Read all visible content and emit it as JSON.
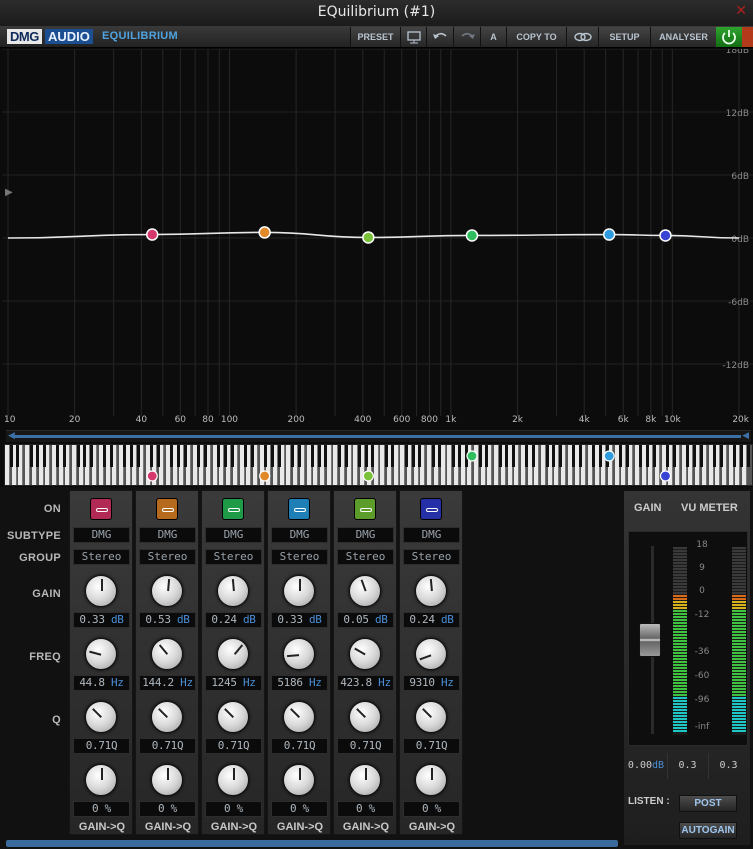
{
  "window": {
    "title": "EQuilibrium (#1)",
    "close": "✕"
  },
  "toolbar": {
    "brand_dmg": "DMG",
    "brand_audio": "AUDIO",
    "product": "EQUILIBRIUM",
    "buttons": [
      {
        "label": "PRESET"
      },
      {
        "label": ""
      },
      {
        "label": ""
      },
      {
        "label": ""
      },
      {
        "label": "A"
      },
      {
        "label": "COPY TO"
      },
      {
        "label": ""
      },
      {
        "label": "SETUP"
      },
      {
        "label": "ANALYSER"
      }
    ],
    "icons": {
      "monitor": "monitor-icon",
      "undo": "undo-icon",
      "redo": "redo-icon",
      "link": "link-icon",
      "power": "power-icon"
    }
  },
  "graph": {
    "db_labels": [
      "18dB",
      "12dB",
      "6dB",
      "0dB",
      "-6dB",
      "-12dB"
    ],
    "freq_labels": [
      "10",
      "20",
      "40",
      "60",
      "80",
      "100",
      "200",
      "400",
      "600",
      "800",
      "1k",
      "2k",
      "4k",
      "6k",
      "8k",
      "10k",
      "20k"
    ]
  },
  "chart_data": {
    "type": "line",
    "title": "",
    "xlabel": "",
    "ylabel": "",
    "x_scale": "log",
    "xlim": [
      10,
      20000
    ],
    "ylim": [
      -18,
      18
    ],
    "y_ticks": [
      18,
      12,
      6,
      0,
      -6,
      -12
    ],
    "series": [
      {
        "values": [
          [
            10,
            0
          ],
          [
            44.8,
            0.33
          ],
          [
            144.2,
            0.53
          ],
          [
            423.8,
            0.05
          ],
          [
            1245,
            0.24
          ],
          [
            5186,
            0.33
          ],
          [
            9310,
            0.24
          ],
          [
            20000,
            0
          ]
        ]
      }
    ],
    "points": [
      {
        "freq": 44.8,
        "gain": 0.33,
        "color": "#d5396b"
      },
      {
        "freq": 144.2,
        "gain": 0.53,
        "color": "#e08a2a"
      },
      {
        "freq": 423.8,
        "gain": 0.05,
        "color": "#7ac23a"
      },
      {
        "freq": 1245,
        "gain": 0.24,
        "color": "#2fbe5e"
      },
      {
        "freq": 5186,
        "gain": 0.33,
        "color": "#2d9bdd"
      },
      {
        "freq": 9310,
        "gain": 0.24,
        "color": "#3a44d4"
      }
    ]
  },
  "rows": {
    "on": "ON",
    "subtype": "SUBTYPE",
    "group": "GROUP",
    "gain": "GAIN",
    "freq": "FREQ",
    "q": "Q"
  },
  "bands": [
    {
      "color": "#b02a55",
      "subtype": "DMG",
      "group": "Stereo",
      "gain_val": "0.33",
      "gain_unit": "dB",
      "freq_val": "44.8",
      "freq_unit": "Hz",
      "q": "0.71Q",
      "amount": "0 %",
      "footer": "GAIN->Q"
    },
    {
      "color": "#b56a1e",
      "subtype": "DMG",
      "group": "Stereo",
      "gain_val": "0.53",
      "gain_unit": "dB",
      "freq_val": "144.2",
      "freq_unit": "Hz",
      "q": "0.71Q",
      "amount": "0 %",
      "footer": "GAIN->Q"
    },
    {
      "color": "#1f9a47",
      "subtype": "DMG",
      "group": "Stereo",
      "gain_val": "0.24",
      "gain_unit": "dB",
      "freq_val": "1245",
      "freq_unit": "Hz",
      "q": "0.71Q",
      "amount": "0 %",
      "footer": "GAIN->Q"
    },
    {
      "color": "#1d7fb6",
      "subtype": "DMG",
      "group": "Stereo",
      "gain_val": "0.33",
      "gain_unit": "dB",
      "freq_val": "5186",
      "freq_unit": "Hz",
      "q": "0.71Q",
      "amount": "0 %",
      "footer": "GAIN->Q"
    },
    {
      "color": "#5c9c2a",
      "subtype": "DMG",
      "group": "Stereo",
      "gain_val": "0.05",
      "gain_unit": "dB",
      "freq_val": "423.8",
      "freq_unit": "Hz",
      "q": "0.71Q",
      "amount": "0 %",
      "footer": "GAIN->Q"
    },
    {
      "color": "#2530a6",
      "subtype": "DMG",
      "group": "Stereo",
      "gain_val": "0.24",
      "gain_unit": "dB",
      "freq_val": "9310",
      "freq_unit": "Hz",
      "q": "0.71Q",
      "amount": "0 %",
      "footer": "GAIN->Q"
    }
  ],
  "meter": {
    "gain_label": "GAIN",
    "vu_label": "VU METER",
    "scale": [
      "18",
      "9",
      "0",
      "-12",
      "-36",
      "-60",
      "-96",
      "-inf"
    ],
    "gain_readout": "0.00",
    "gain_unit": "dB",
    "left_readout": "0.3",
    "right_readout": "0.3",
    "listen_label": "LISTEN :",
    "post_label": "POST",
    "autogain_label": "AUTOGAIN"
  }
}
